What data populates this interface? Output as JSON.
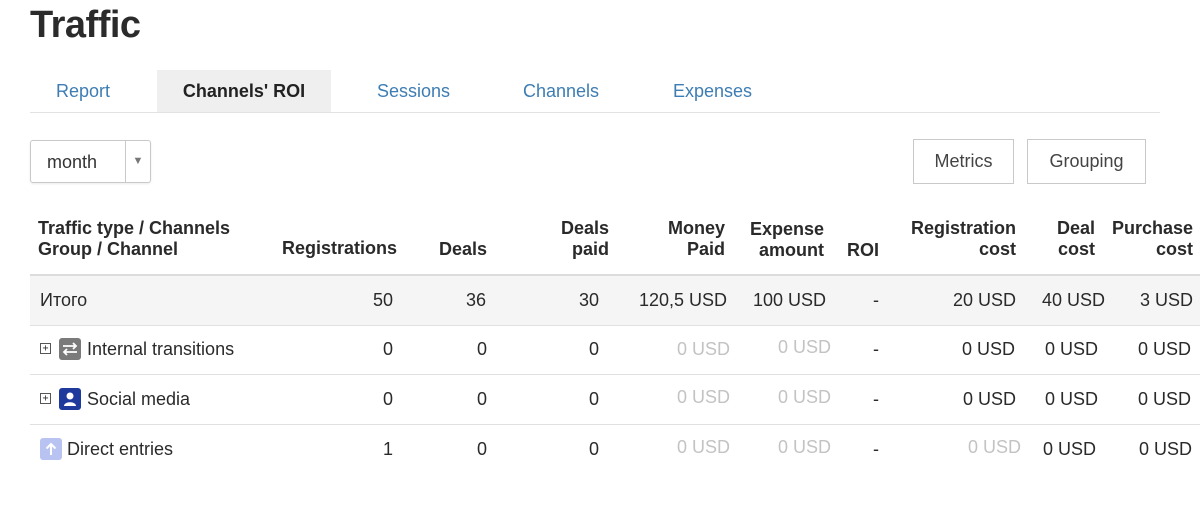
{
  "page": {
    "title": "Traffic"
  },
  "tabs": [
    "Report",
    "Channels' ROI",
    "Sessions",
    "Channels",
    "Expenses"
  ],
  "active_tab": "Channels' ROI",
  "period_select": {
    "value": "month",
    "arrow": "▼"
  },
  "buttons": {
    "metrics": "Metrics",
    "grouping": "Grouping"
  },
  "columns": {
    "channel_line1": "Traffic type / Channels",
    "channel_line2": "Group / Channel",
    "registrations": "Registrations",
    "deals": "Deals",
    "deals_paid_line1": "Deals",
    "deals_paid_line2": "paid",
    "money_paid_line1": "Money",
    "money_paid_line2": "Paid",
    "expense_line1": "Expense",
    "expense_line2": "amount",
    "roi": "ROI",
    "reg_cost_line1": "Registration",
    "reg_cost_line2": "cost",
    "deal_cost_line1": "Deal",
    "deal_cost_line2": "cost",
    "purchase_cost_line1": "Purchase",
    "purchase_cost_line2": "cost"
  },
  "total_row": {
    "label": "Итого",
    "registrations": "50",
    "deals": "36",
    "deals_paid": "30",
    "money_paid": "120,5 USD",
    "expense": "100 USD",
    "roi": "-",
    "reg_cost": "20 USD",
    "deal_cost": "40 USD",
    "purchase_cost": "3 USD"
  },
  "rows": [
    {
      "label": "Internal transitions",
      "expand": "+",
      "icon": "arrows-swap-icon",
      "icon_color": "#7a7a7a",
      "registrations": "0",
      "deals": "0",
      "deals_paid": "0",
      "money_paid": "0 USD",
      "expense": "0 USD",
      "roi": "-",
      "reg_cost": "0 USD",
      "deal_cost": "0 USD",
      "purchase_cost": "0 USD"
    },
    {
      "label": "Social media",
      "expand": "+",
      "icon": "person-icon",
      "icon_color": "#1e3a9c",
      "registrations": "0",
      "deals": "0",
      "deals_paid": "0",
      "money_paid": "0 USD",
      "expense": "0 USD",
      "roi": "-",
      "reg_cost": "0 USD",
      "deal_cost": "0 USD",
      "purchase_cost": "0 USD"
    },
    {
      "label": "Direct entries",
      "icon": "arrow-up-icon",
      "icon_color": "#b9c3f2",
      "registrations": "1",
      "deals": "0",
      "deals_paid": "0",
      "money_paid": "0 USD",
      "expense": "0 USD",
      "roi": "-",
      "reg_cost": "0 USD",
      "deal_cost": "0 USD",
      "purchase_cost": "0 USD"
    }
  ],
  "colors": {
    "link": "#3d7db3",
    "muted_value": "#c3c3c3",
    "active_tab_bg": "#efefef"
  }
}
